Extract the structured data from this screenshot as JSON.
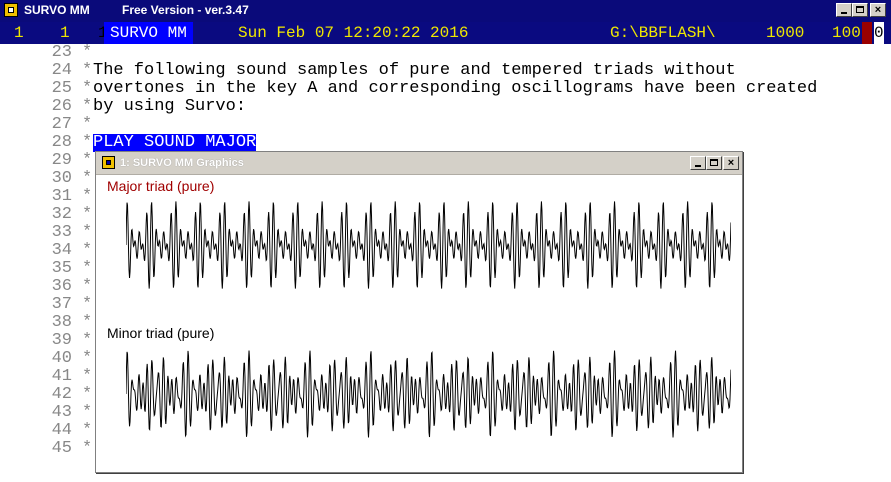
{
  "window": {
    "title": "SURVO MM",
    "subtitle": "Free Version  -  ver.3.47",
    "buttons": {
      "minimize": "_",
      "maximize": "□",
      "close": "×"
    }
  },
  "status": {
    "col": "1",
    "row": "1",
    "marker": "1",
    "app_badge": "SURVO MM",
    "datetime": "Sun Feb 07 12:20:22 2016",
    "path": "G:\\BBFLASH\\",
    "edit_size": "1000",
    "edit_cols": "100",
    "flag": "0",
    "colors": {
      "bar": "#0a0a80",
      "text": "#f0e800",
      "badge": "#0000ff",
      "flag_bg": "#9a0000"
    }
  },
  "editor": {
    "lines": [
      {
        "num": "23",
        "mark": "*",
        "text": ""
      },
      {
        "num": "24",
        "mark": "*",
        "text": "The following sound samples of pure and tempered triads without"
      },
      {
        "num": "25",
        "mark": "*",
        "text": "overtones in the key A and corresponding oscillograms have been created"
      },
      {
        "num": "26",
        "mark": "*",
        "text": "by using Survo:"
      },
      {
        "num": "27",
        "mark": "*",
        "text": ""
      },
      {
        "num": "28",
        "mark": "*",
        "text": "PLAY SOUND MAJOR",
        "highlight": true
      },
      {
        "num": "29",
        "mark": "*",
        "text": ""
      },
      {
        "num": "30",
        "mark": "*",
        "text": ""
      },
      {
        "num": "31",
        "mark": "*",
        "text": ""
      },
      {
        "num": "32",
        "mark": "*",
        "text": ""
      },
      {
        "num": "33",
        "mark": "*",
        "text": ""
      },
      {
        "num": "34",
        "mark": "*",
        "text": ""
      },
      {
        "num": "35",
        "mark": "*",
        "text": ""
      },
      {
        "num": "36",
        "mark": "*",
        "text": ""
      },
      {
        "num": "37",
        "mark": "*",
        "text": ""
      },
      {
        "num": "38",
        "mark": "*",
        "text": ""
      },
      {
        "num": "39",
        "mark": "*",
        "text": ""
      },
      {
        "num": "40",
        "mark": "*",
        "text": ""
      },
      {
        "num": "41",
        "mark": "*",
        "text": ""
      },
      {
        "num": "42",
        "mark": "*",
        "text": ""
      },
      {
        "num": "43",
        "mark": "*",
        "text": ""
      },
      {
        "num": "44",
        "mark": "*",
        "text": ""
      },
      {
        "num": "45",
        "mark": "*",
        "text": ""
      }
    ]
  },
  "graphics": {
    "title": "1: SURVO MM  Graphics",
    "buttons": {
      "minimize": "_",
      "maximize": "□",
      "close": "×"
    },
    "plots": [
      {
        "label": "Major triad (pure)",
        "label_color": "#a00000"
      },
      {
        "label": "Minor triad (pure)",
        "label_color": "#000000"
      }
    ]
  }
}
